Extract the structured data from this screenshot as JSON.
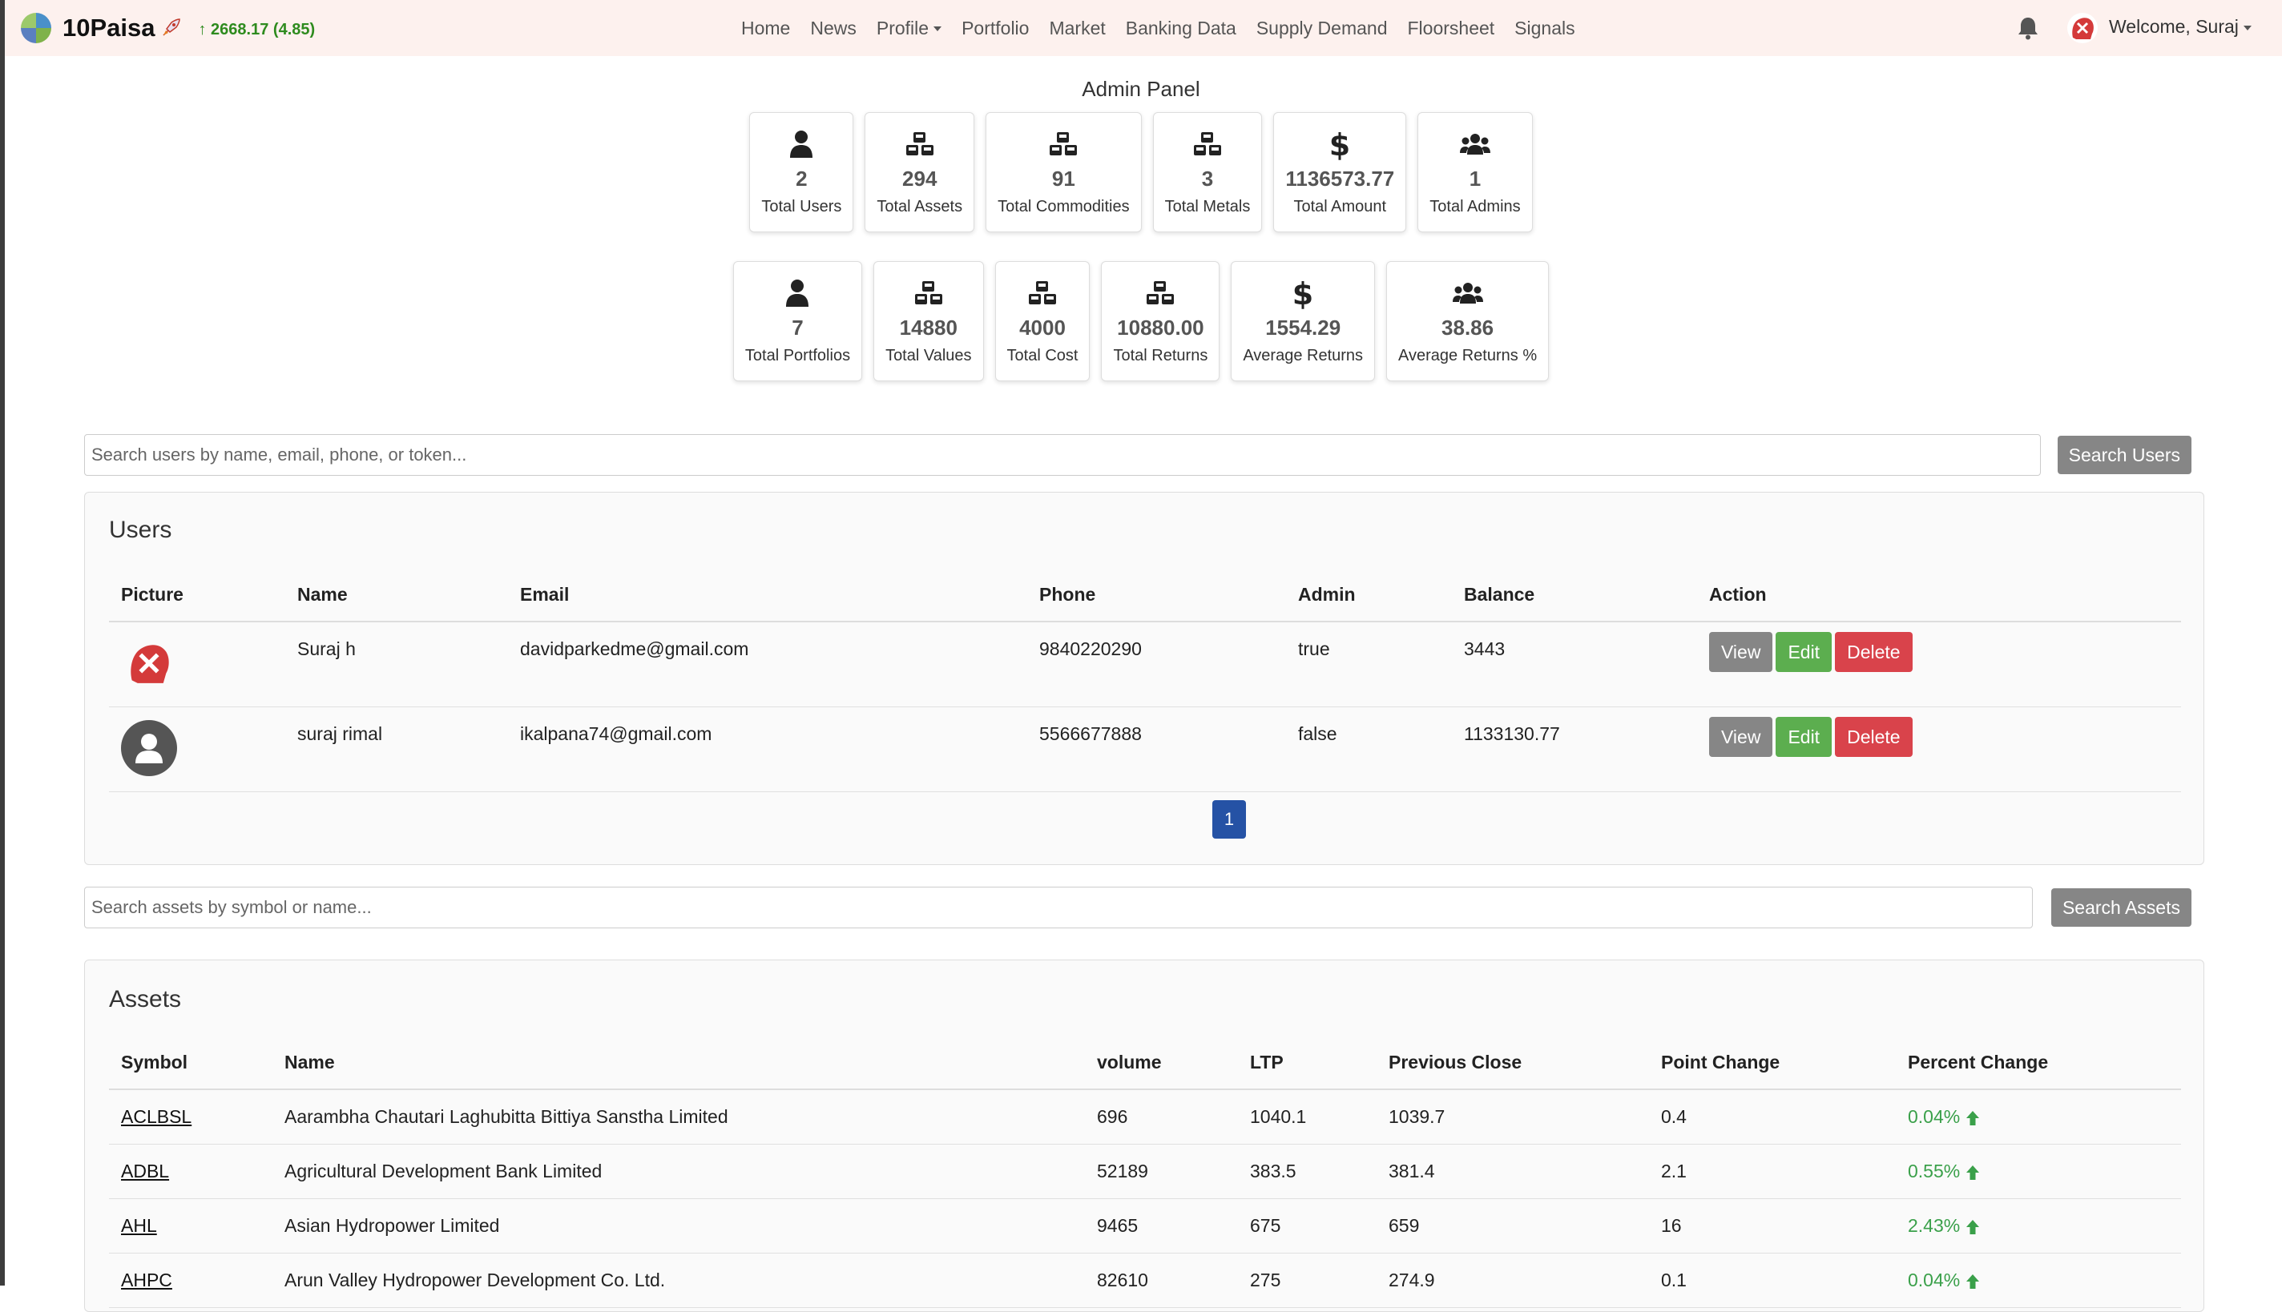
{
  "app": {
    "brand": "10Paisa",
    "ticker": "↑ 2668.17 (4.85)",
    "nav": [
      "Home",
      "News",
      "Profile",
      "Portfolio",
      "Market",
      "Banking Data",
      "Supply Demand",
      "Floorsheet",
      "Signals"
    ],
    "welcome": "Welcome, Suraj"
  },
  "admin": {
    "title": "Admin Panel",
    "stats_row1": [
      {
        "icon": "user-icon",
        "value": "2",
        "label": "Total Users"
      },
      {
        "icon": "cubes-icon",
        "value": "294",
        "label": "Total Assets"
      },
      {
        "icon": "cubes-icon",
        "value": "91",
        "label": "Total Commodities"
      },
      {
        "icon": "cubes-icon",
        "value": "3",
        "label": "Total Metals"
      },
      {
        "icon": "dollar-icon",
        "value": "1136573.77",
        "label": "Total Amount"
      },
      {
        "icon": "users-icon",
        "value": "1",
        "label": "Total Admins"
      }
    ],
    "stats_row2": [
      {
        "icon": "user-icon",
        "value": "7",
        "label": "Total Portfolios"
      },
      {
        "icon": "cubes-icon",
        "value": "14880",
        "label": "Total Values"
      },
      {
        "icon": "cubes-icon",
        "value": "4000",
        "label": "Total Cost"
      },
      {
        "icon": "cubes-icon",
        "value": "10880.00",
        "label": "Total Returns"
      },
      {
        "icon": "dollar-icon",
        "value": "1554.29",
        "label": "Average Returns"
      },
      {
        "icon": "users-icon",
        "value": "38.86",
        "label": "Average Returns %"
      }
    ]
  },
  "user_search": {
    "placeholder": "Search users by name, email, phone, or token...",
    "value": "",
    "button": "Search Users"
  },
  "users": {
    "title": "Users",
    "columns": [
      "Picture",
      "Name",
      "Email",
      "Phone",
      "Admin",
      "Balance",
      "Action"
    ],
    "rows": [
      {
        "avatar": "tools-avatar-icon",
        "name": "Suraj h",
        "email": "davidparkedme@gmail.com",
        "phone": "9840220290",
        "admin": "true",
        "balance": "3443"
      },
      {
        "avatar": "default-avatar-icon",
        "name": "suraj rimal",
        "email": "ikalpana74@gmail.com",
        "phone": "5566677888",
        "admin": "false",
        "balance": "1133130.77"
      }
    ],
    "actions": {
      "view": "View",
      "edit": "Edit",
      "delete": "Delete"
    },
    "page": "1"
  },
  "asset_search": {
    "placeholder": "Search assets by symbol or name...",
    "value": "",
    "button": "Search Assets"
  },
  "assets": {
    "title": "Assets",
    "columns": [
      "Symbol",
      "Name",
      "volume",
      "LTP",
      "Previous Close",
      "Point Change",
      "Percent Change"
    ],
    "rows": [
      {
        "symbol": "ACLBSL",
        "name": "Aarambha Chautari Laghubitta Bittiya Sanstha Limited",
        "volume": "696",
        "ltp": "1040.1",
        "prev": "1039.7",
        "point": "0.4",
        "pct": "0.04%"
      },
      {
        "symbol": "ADBL",
        "name": "Agricultural Development Bank Limited",
        "volume": "52189",
        "ltp": "383.5",
        "prev": "381.4",
        "point": "2.1",
        "pct": "0.55%"
      },
      {
        "symbol": "AHL",
        "name": "Asian Hydropower Limited",
        "volume": "9465",
        "ltp": "675",
        "prev": "659",
        "point": "16",
        "pct": "2.43%"
      },
      {
        "symbol": "AHPC",
        "name": "Arun Valley Hydropower Development Co. Ltd.",
        "volume": "82610",
        "ltp": "275",
        "prev": "274.9",
        "point": "0.1",
        "pct": "0.04%"
      }
    ]
  },
  "colors": {
    "navbar_bg": "#fdf1ee",
    "positive": "#3aa04a",
    "view_btn": "#868686",
    "edit_btn": "#5cae4f",
    "delete_btn": "#d9434b",
    "page_btn": "#2552a5"
  }
}
